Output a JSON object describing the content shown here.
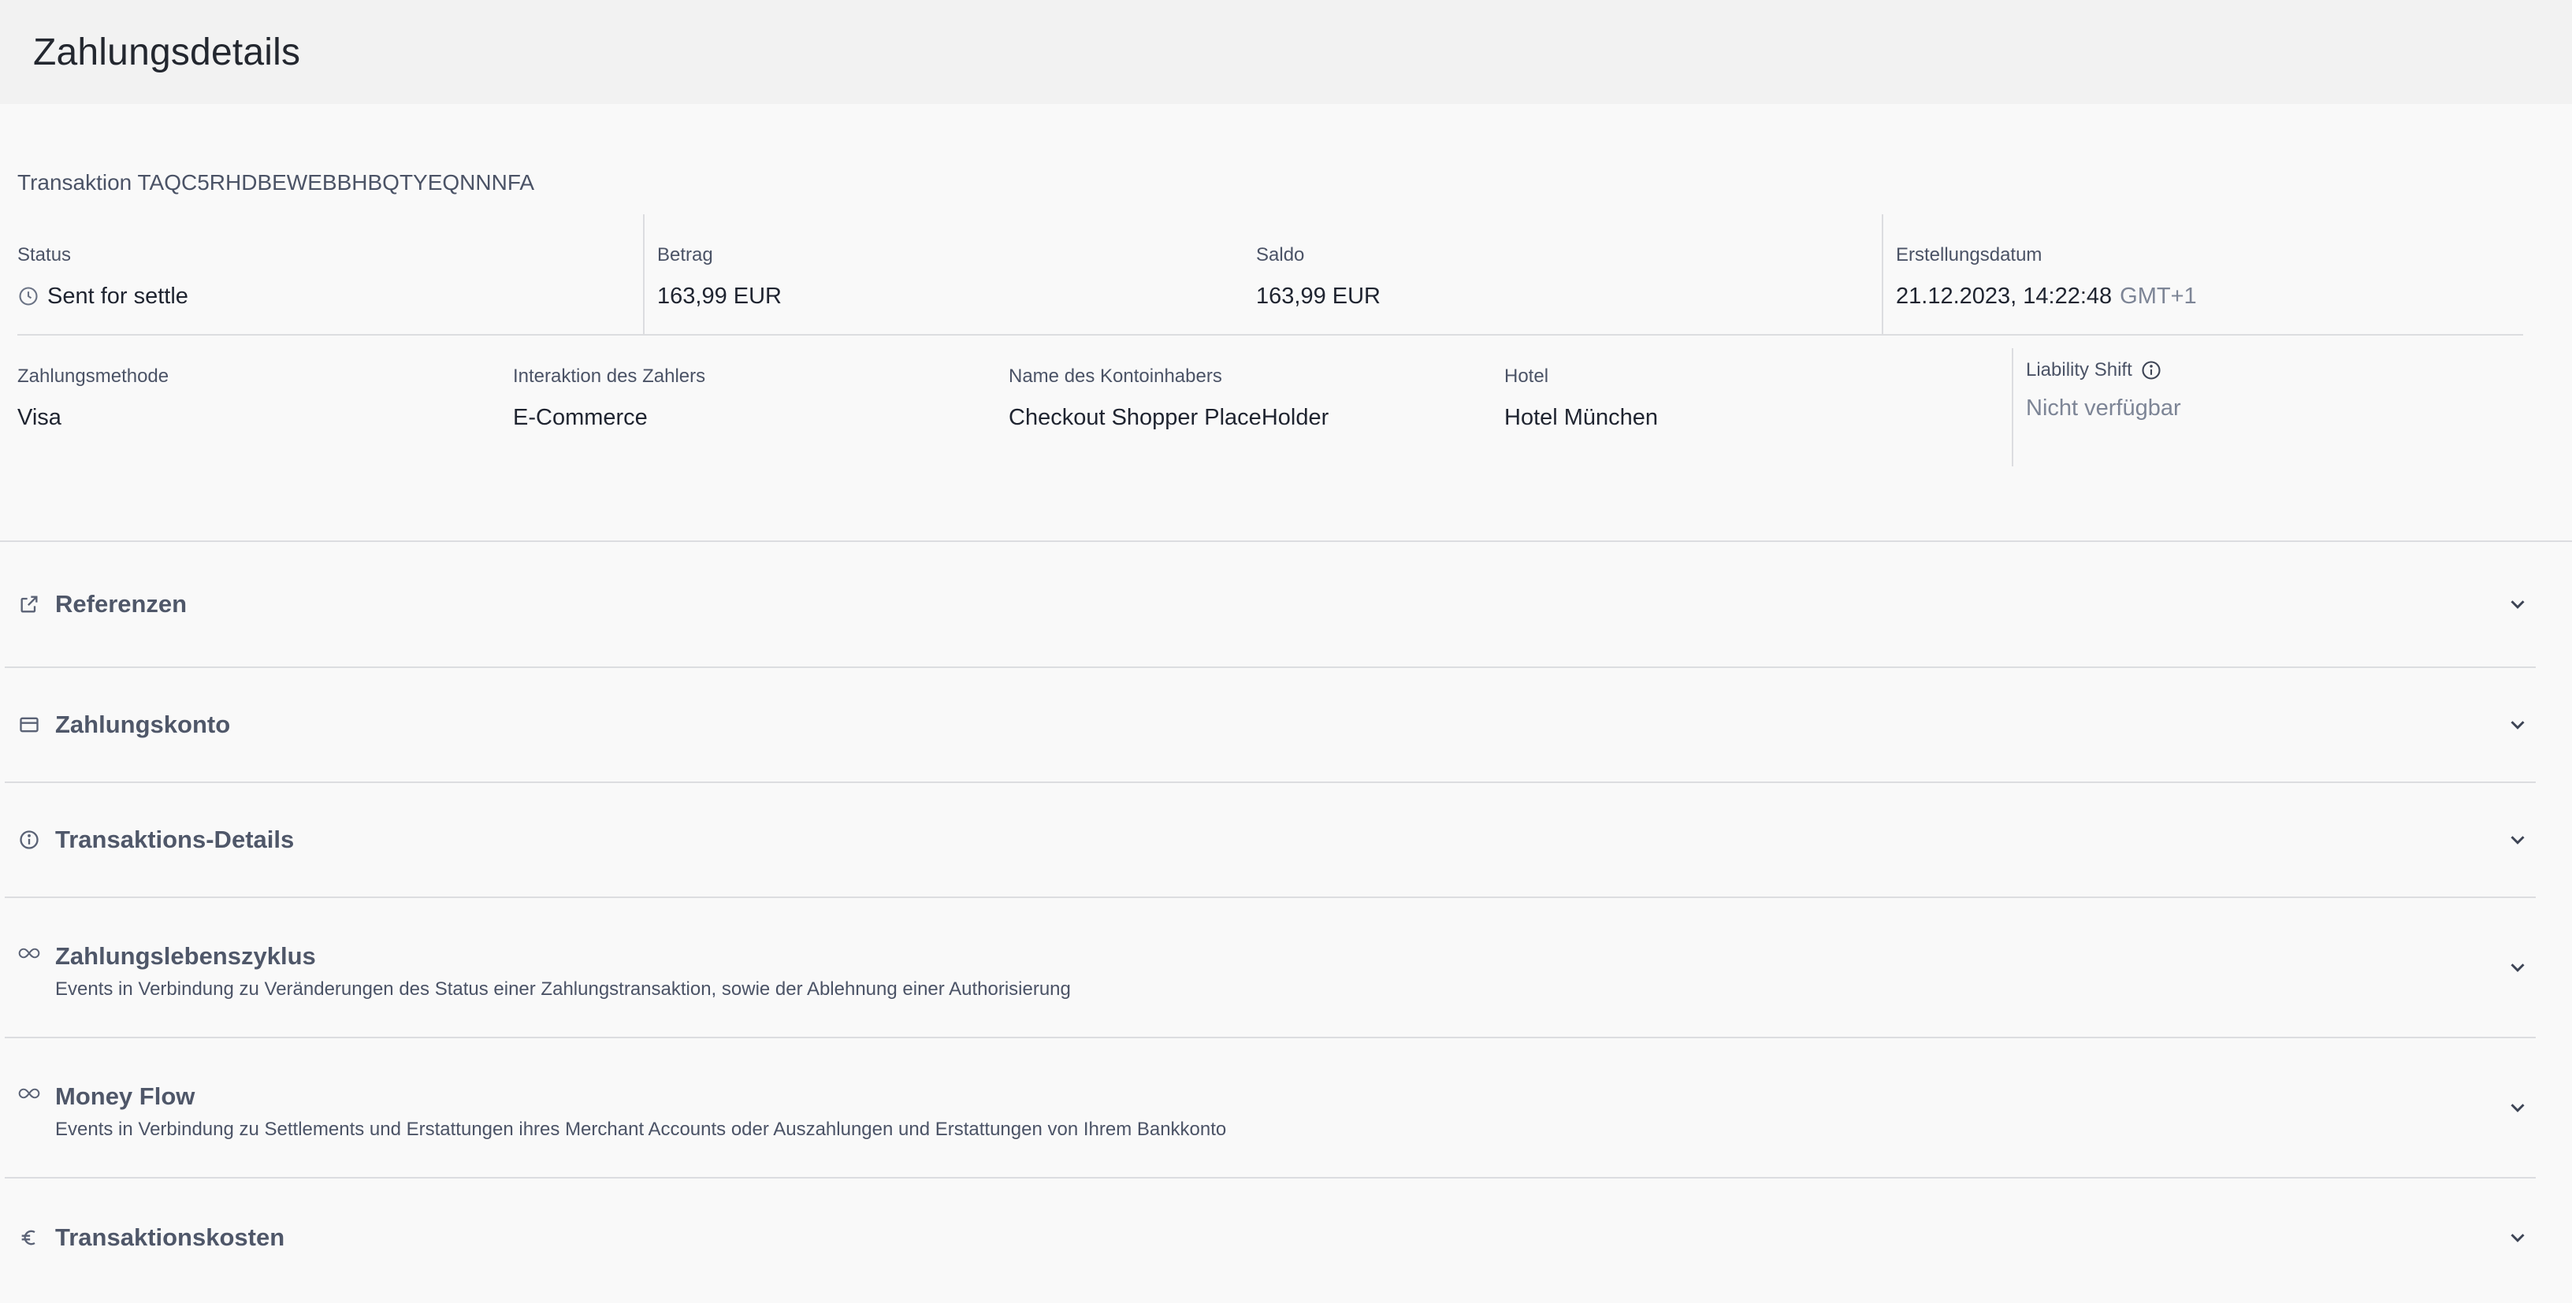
{
  "header": {
    "title": "Zahlungsdetails"
  },
  "transaction": {
    "title": "Transaktion TAQC5RHDBEWEBBHBQTYEQNNNFA",
    "status_label": "Status",
    "status_value": "Sent for settle",
    "amount_label": "Betrag",
    "amount_value": "163,99 EUR",
    "balance_label": "Saldo",
    "balance_value": "163,99 EUR",
    "created_label": "Erstellungsdatum",
    "created_value": "21.12.2023, 14:22:48",
    "created_tz": "GMT+1",
    "payment_method_label": "Zahlungsmethode",
    "payment_method_value": "Visa",
    "interaction_label": "Interaktion des Zahlers",
    "interaction_value": "E-Commerce",
    "holder_label": "Name des Kontoinhabers",
    "holder_value": "Checkout Shopper PlaceHolder",
    "hotel_label": "Hotel",
    "hotel_value": "Hotel München",
    "liability_label": "Liability Shift",
    "liability_value": "Nicht verfügbar"
  },
  "sections": [
    {
      "title": "Referenzen",
      "icon": "external-link-icon"
    },
    {
      "title": "Zahlungskonto",
      "icon": "credit-card-icon"
    },
    {
      "title": "Transaktions-Details",
      "icon": "info-icon"
    },
    {
      "title": "Zahlungslebenszyklus",
      "subtitle": "Events in Verbindung zu Veränderungen des Status einer Zahlungstransaktion, sowie der Ablehnung einer Authorisierung",
      "icon": "infinity-icon"
    },
    {
      "title": "Money Flow",
      "subtitle": "Events in Verbindung zu Settlements und Erstattungen ihres Merchant Accounts oder Auszahlungen und Erstattungen von Ihrem Bankkonto",
      "icon": "infinity-icon"
    },
    {
      "title": "Transaktionskosten",
      "icon": "euro-icon"
    }
  ]
}
